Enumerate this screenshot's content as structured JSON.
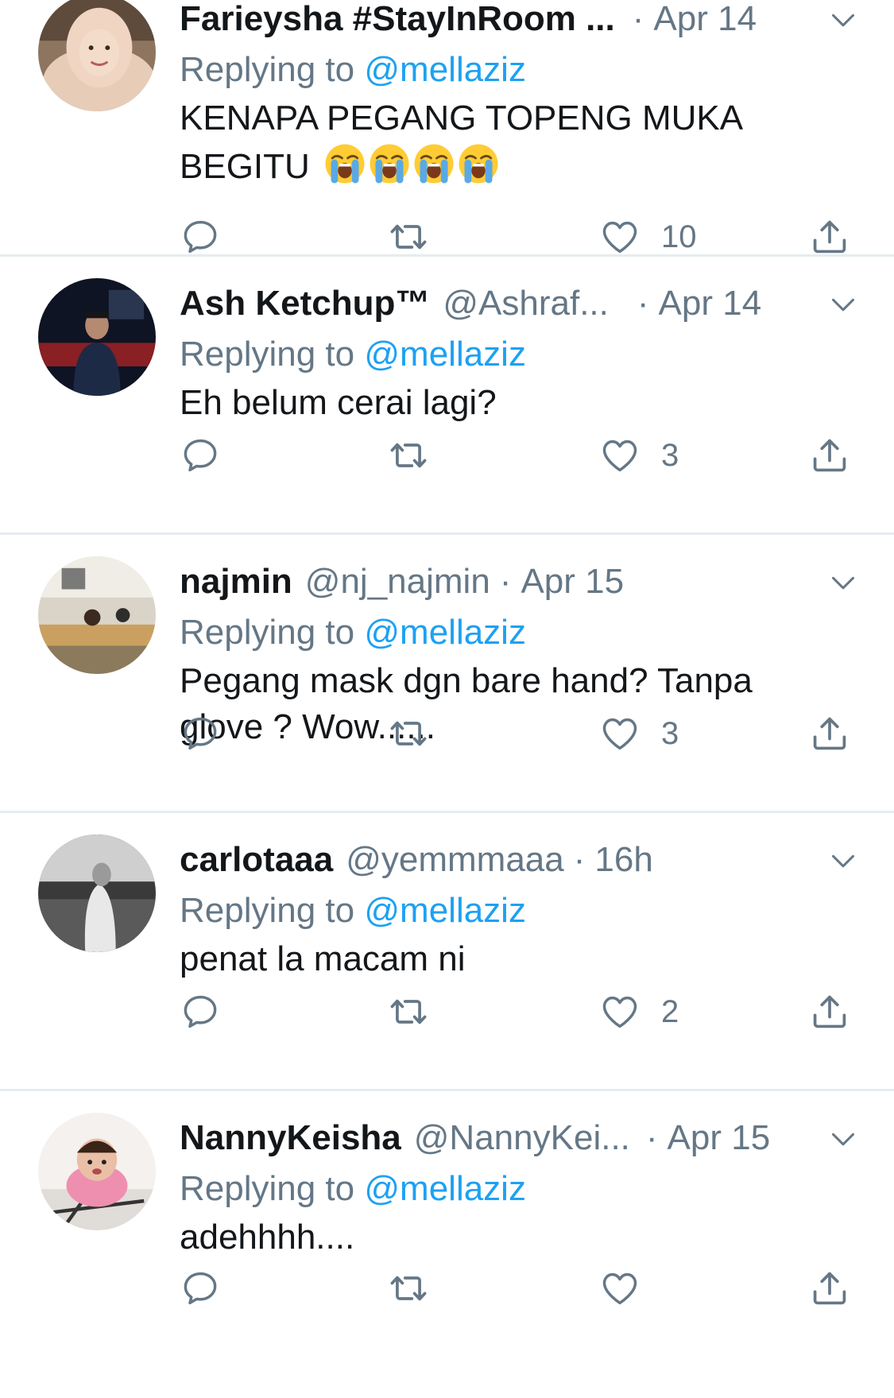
{
  "colors": {
    "accent": "#1da1f2",
    "secondary": "#657786",
    "text": "#14171a",
    "divider": "#e6ecf0"
  },
  "replies": [
    {
      "name": "Farieysha #StayInRoom ...",
      "handle": "",
      "dot": "·",
      "time": "Apr 14",
      "replying_prefix": "Replying to",
      "replying_to": "@mellaziz",
      "text": "KENAPA PEGANG TOPENG MUKA BEGITU",
      "emoji": [
        "loudly-crying-face",
        "loudly-crying-face",
        "loudly-crying-face",
        "loudly-crying-face"
      ],
      "likes": "10"
    },
    {
      "name": "Ash Ketchup™",
      "handle": "@Ashraf...",
      "dot": "·",
      "time": "Apr 14",
      "replying_prefix": "Replying to",
      "replying_to": "@mellaziz",
      "text": "Eh belum cerai lagi?",
      "likes": "3"
    },
    {
      "name": "najmin",
      "handle": "@nj_najmin",
      "dot": "·",
      "time": "Apr 15",
      "replying_prefix": "Replying to",
      "replying_to": "@mellaziz",
      "text": "Pegang mask dgn bare hand? Tanpa glove ? Wow......",
      "likes": "3"
    },
    {
      "name": "carlotaaa",
      "handle": "@yemmmaaa",
      "dot": "·",
      "time": "16h",
      "replying_prefix": "Replying to",
      "replying_to": "@mellaziz",
      "text": "penat la macam ni",
      "likes": "2"
    },
    {
      "name": "NannyKeisha",
      "handle": "@NannyKei...",
      "dot": "·",
      "time": "Apr 15",
      "replying_prefix": "Replying to",
      "replying_to": "@mellaziz",
      "text": "adehhhh....",
      "likes": ""
    }
  ]
}
